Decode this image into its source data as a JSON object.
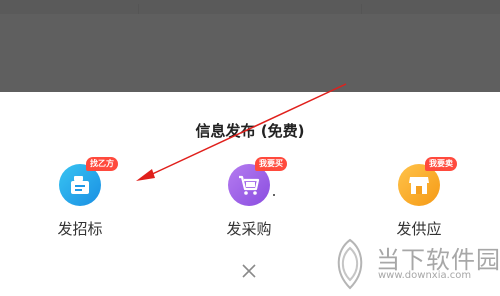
{
  "sheet": {
    "title": "信息发布 (免费)",
    "options": [
      {
        "label": "发招标",
        "badge": "找乙方",
        "icon": "tender-board-icon",
        "color": "#1fa3ea"
      },
      {
        "label": "发采购",
        "badge": "我要买",
        "icon": "shopping-cart-icon",
        "color": "#9a5ce6"
      },
      {
        "label": "发供应",
        "badge": "我要卖",
        "icon": "storefront-icon",
        "color": "#f7a824"
      }
    ],
    "close_icon": "close-icon"
  },
  "colors": {
    "overlay": "#5f5f5f",
    "badge": "#ff4a3d",
    "annotation_arrow": "#e0201c"
  },
  "watermark": {
    "name": "当下软件园",
    "url": "www.downxia.com"
  }
}
